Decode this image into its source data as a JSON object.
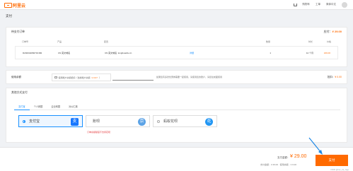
{
  "header": {
    "logo_text": "阿里云",
    "links": [
      "购物车",
      "工单",
      "简体中文"
    ]
  },
  "page": {
    "title": "支付"
  },
  "order": {
    "section_title": "待支付订单",
    "total_label": "应付：",
    "total_value": "¥ 29.00",
    "columns": [
      "订单号",
      "产品",
      "配置",
      "",
      "数量",
      "时长",
      "价格"
    ],
    "row": {
      "order_id": "D202344060716182",
      "product": "CN 英文域名",
      "config": "CN 英文域名: longhuashu.cn",
      "detail_link": "详细",
      "quantity": "1",
      "duration": "12 个月",
      "price": "¥29.00"
    }
  },
  "coupon": {
    "label": "使用余额",
    "checkbox_text": "使用账户余额抵扣（当前账户余额",
    "balance": "¥ 0.07",
    "balance_suffix": "）",
    "tip": "如果您有多张优惠券需要一起使用，请使用您的账户，请您往前面使用",
    "deduct_label": "抵扣：",
    "deduct_value": "¥ 0.00"
  },
  "payment": {
    "section_title": "其他方式支付",
    "tabs": [
      "支付宝",
      "个人网银",
      "企业网银",
      "对公汇款"
    ],
    "methods": [
      {
        "name": "支付宝",
        "icon": "alipay-icon",
        "glyph": "支"
      },
      {
        "name": "账呗",
        "icon": "jd-icon",
        "glyph": "京"
      },
      {
        "name": "蚂蚁花呗",
        "icon": "huabei-icon",
        "glyph": "花"
      }
    ],
    "warning": "订单余额额度不支持花呗"
  },
  "footer": {
    "pay_label": "支付金额：",
    "pay_amount": "¥ 29.00",
    "sub_text": "支付金额：¥ 29.00 · 使用余额：¥ 0.00",
    "pay_button": "支付",
    "watermark": "CSDN @han_xia_zage"
  },
  "colors": {
    "accent": "#ff6a00",
    "link": "#1890ff",
    "warn": "#e4393c"
  }
}
